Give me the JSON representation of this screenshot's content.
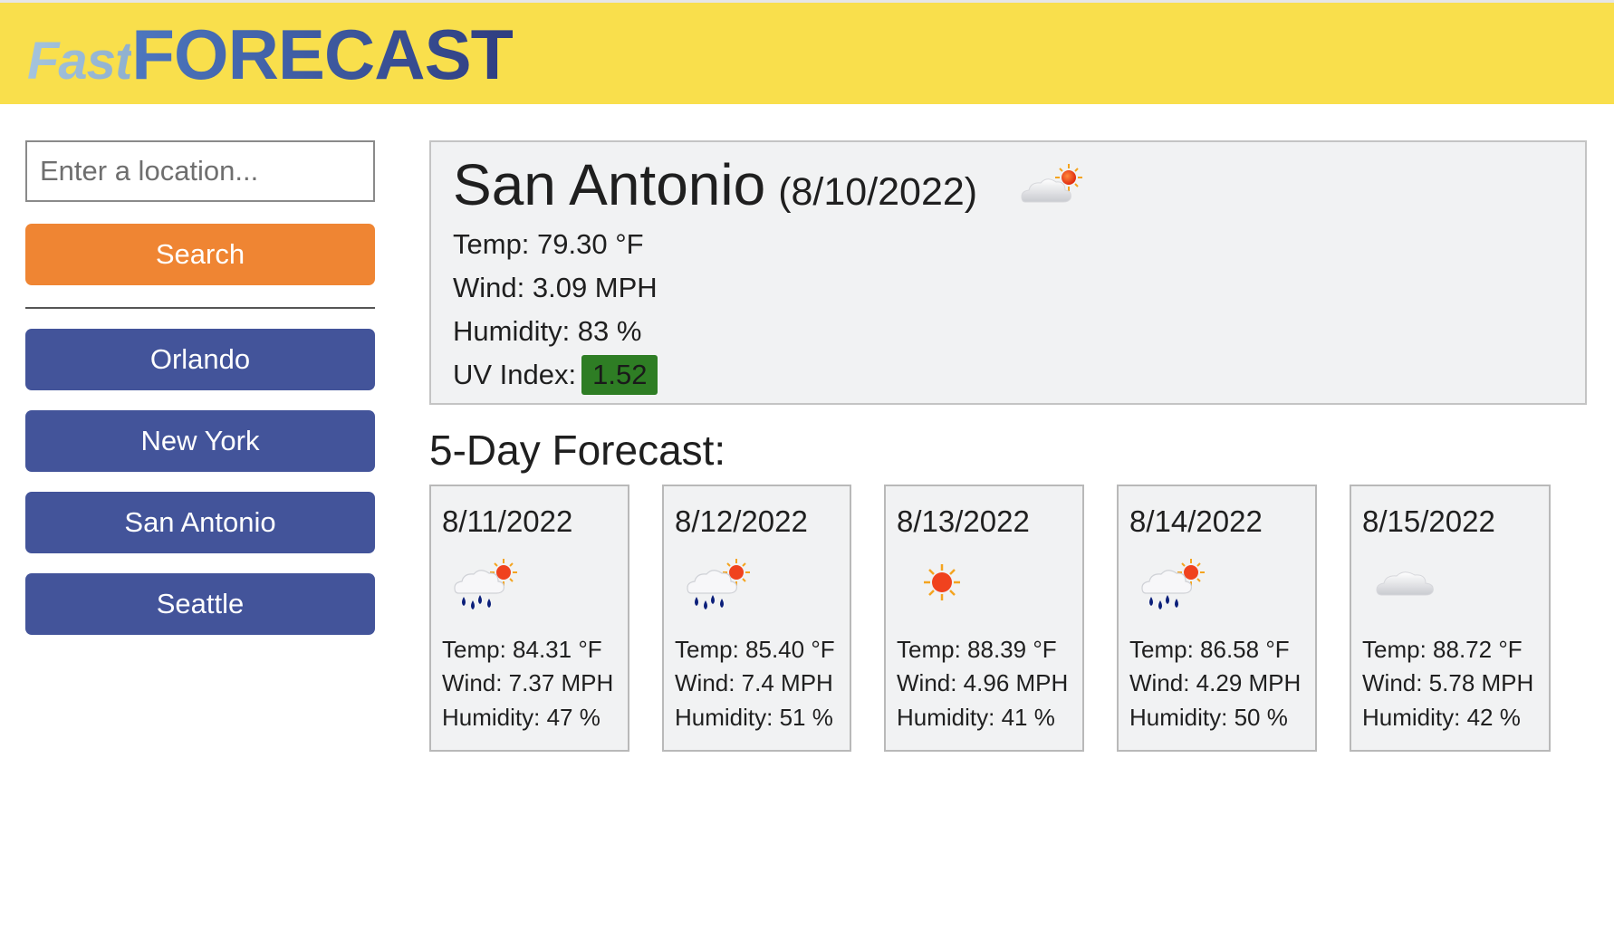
{
  "header": {
    "logo_fast": "Fast",
    "logo_forecast": "FORECAST"
  },
  "sidebar": {
    "search_placeholder": "Enter a location...",
    "search_value": "",
    "search_button": "Search",
    "history": [
      "Orlando",
      "New York",
      "San Antonio",
      "Seattle"
    ]
  },
  "current": {
    "city": "San Antonio",
    "date": "(8/10/2022)",
    "icon": "few-clouds-icon",
    "temp": "Temp: 79.30 °F",
    "wind": "Wind: 3.09 MPH",
    "humidity": "Humidity: 83 %",
    "uv_label": "UV Index:",
    "uv_value": "1.52",
    "uv_color": "#2e7d24"
  },
  "forecast": {
    "title": "5-Day Forecast:",
    "days": [
      {
        "date": "8/11/2022",
        "icon": "rain-sun-icon",
        "temp": "Temp: 84.31 °F",
        "wind": "Wind: 7.37 MPH",
        "humidity": "Humidity: 47 %"
      },
      {
        "date": "8/12/2022",
        "icon": "rain-sun-icon",
        "temp": "Temp: 85.40 °F",
        "wind": "Wind: 7.4 MPH",
        "humidity": "Humidity: 51 %"
      },
      {
        "date": "8/13/2022",
        "icon": "sun-icon",
        "temp": "Temp: 88.39 °F",
        "wind": "Wind: 4.96 MPH",
        "humidity": "Humidity: 41 %"
      },
      {
        "date": "8/14/2022",
        "icon": "rain-sun-icon",
        "temp": "Temp: 86.58 °F",
        "wind": "Wind: 4.29 MPH",
        "humidity": "Humidity: 50 %"
      },
      {
        "date": "8/15/2022",
        "icon": "cloud-icon",
        "temp": "Temp: 88.72 °F",
        "wind": "Wind: 5.78 MPH",
        "humidity": "Humidity: 42 %"
      }
    ]
  },
  "colors": {
    "header_bg": "#f9df4c",
    "search_button": "#ef8533",
    "history_button": "#43549a",
    "panel_bg": "#f1f2f3"
  }
}
